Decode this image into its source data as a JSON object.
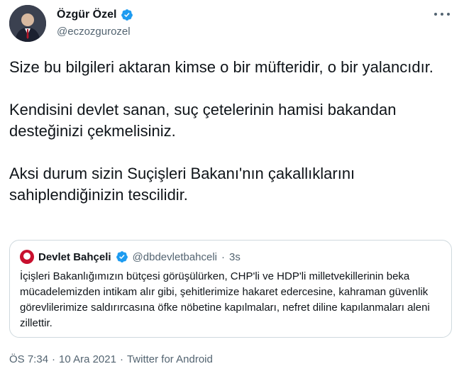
{
  "author": {
    "name": "Özgür Özel",
    "handle": "@eczozgurozel",
    "avatar_icon": "profile-photo",
    "verified_icon": "verified-badge-icon",
    "verified_color": "#1d9bf0"
  },
  "tweet": {
    "paragraphs": [
      "Size bu bilgileri aktaran kimse o bir müfteridir, o bir yalancıdır.",
      "Kendisini devlet sanan, suç çetelerinin hamisi bakandan desteğinizi çekmelisiniz.",
      "Aksi durum sizin Suçişleri Bakanı'nın çakallıklarını sahiplendiğinizin tescilidir."
    ]
  },
  "quoted_tweet": {
    "name": "Devlet Bahçeli",
    "handle": "@dbdevletbahceli",
    "separator": "·",
    "time": "3s",
    "text": "İçişleri Bakanlığımızın bütçesi görüşülürken, CHP'li ve HDP'li milletvekillerinin beka mücadelemizden intikam alır gibi, şehitlerimize hakaret edercesine, kahraman güvenlik görevlilerimize saldırırcasına öfke nöbetine kapılmaları, nefret diline kapılanmaları aleni zillettir.",
    "avatar_color": "#c8102e"
  },
  "meta": {
    "time": "ÖS 7:34",
    "separator1": "·",
    "date": "10 Ara 2021",
    "separator2": "·",
    "source": "Twitter for Android"
  },
  "colors": {
    "text": "#0f1419",
    "secondary": "#536471",
    "border": "#cfd9de"
  }
}
